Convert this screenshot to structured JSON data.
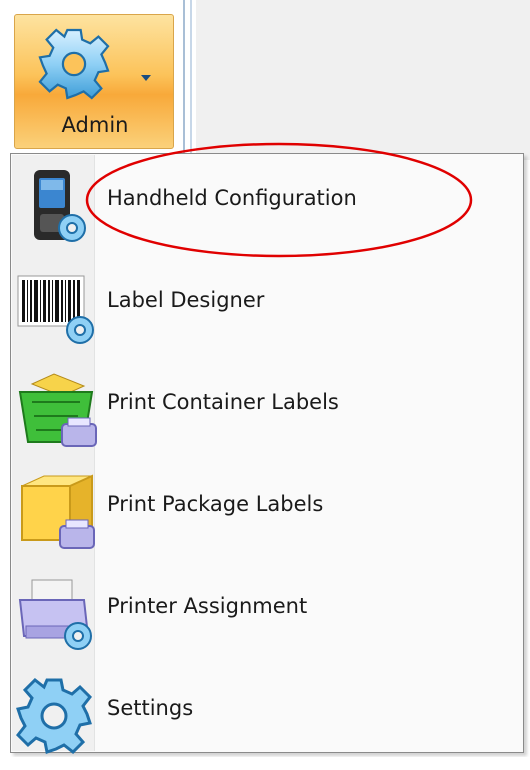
{
  "ribbon": {
    "admin_button": {
      "label": "Admin",
      "icon": "gear-icon",
      "has_dropdown": true
    }
  },
  "menu": {
    "items": [
      {
        "label": "Handheld Configuration",
        "icon": "handheld-config-icon"
      },
      {
        "label": "Label Designer",
        "icon": "barcode-gear-icon"
      },
      {
        "label": "Print Container Labels",
        "icon": "container-printer-icon"
      },
      {
        "label": "Print Package Labels",
        "icon": "package-printer-icon"
      },
      {
        "label": "Printer Assignment",
        "icon": "printer-gear-icon"
      },
      {
        "label": "Settings",
        "icon": "gear-icon"
      }
    ]
  },
  "colors": {
    "admin_button_active": "#fcc35a",
    "annotation": "#e00000"
  }
}
